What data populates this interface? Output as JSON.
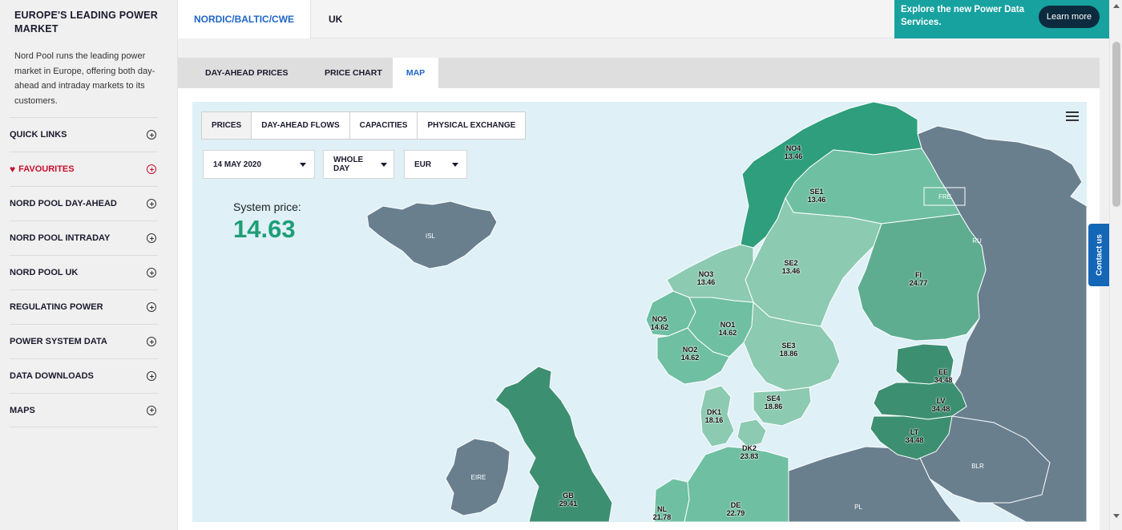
{
  "sidebar": {
    "title": "EUROPE'S LEADING POWER MARKET",
    "description": "Nord Pool runs the leading power market in Europe, offering both day-ahead and intraday markets to its customers.",
    "items": [
      {
        "label": "QUICK LINKS"
      },
      {
        "label": "FAVOURITES"
      },
      {
        "label": "NORD POOL DAY-AHEAD"
      },
      {
        "label": "NORD POOL INTRADAY"
      },
      {
        "label": "NORD POOL UK"
      },
      {
        "label": "REGULATING POWER"
      },
      {
        "label": "POWER SYSTEM DATA"
      },
      {
        "label": "DATA DOWNLOADS"
      },
      {
        "label": "MAPS"
      }
    ]
  },
  "header": {
    "region_tabs": [
      "NORDIC/BALTIC/CWE",
      "UK"
    ],
    "promo": {
      "text": "Explore the new Power Data Services.",
      "button": "Learn more"
    }
  },
  "view_tabs": [
    "DAY-AHEAD PRICES",
    "PRICE CHART",
    "MAP"
  ],
  "map": {
    "mode_tabs": [
      "PRICES",
      "DAY-AHEAD FLOWS",
      "CAPACITIES",
      "PHYSICAL EXCHANGE"
    ],
    "date": "14 MAY 2020",
    "period": "WHOLE DAY",
    "currency": "EUR",
    "system_price_label": "System price:",
    "system_price_value": "14.63",
    "zones": [
      {
        "code": "NO4",
        "price": "13.46"
      },
      {
        "code": "SE1",
        "price": "13.46"
      },
      {
        "code": "SE2",
        "price": "13.46"
      },
      {
        "code": "NO3",
        "price": "13.46"
      },
      {
        "code": "FI",
        "price": "24.77"
      },
      {
        "code": "NO5",
        "price": "14.62"
      },
      {
        "code": "NO1",
        "price": "14.62"
      },
      {
        "code": "NO2",
        "price": "14.62"
      },
      {
        "code": "SE3",
        "price": "18.86"
      },
      {
        "code": "EE",
        "price": "34.48"
      },
      {
        "code": "LV",
        "price": "34.48"
      },
      {
        "code": "LT",
        "price": "34.48"
      },
      {
        "code": "SE4",
        "price": "18.86"
      },
      {
        "code": "DK1",
        "price": "18.16"
      },
      {
        "code": "DK2",
        "price": "23.83"
      },
      {
        "code": "GB",
        "price": "29.41"
      },
      {
        "code": "NL",
        "price": "21.78"
      },
      {
        "code": "DE",
        "price": "22.79"
      }
    ],
    "other_areas": [
      "ISL",
      "FRE",
      "RU",
      "EIRE",
      "BLR",
      "PL"
    ]
  },
  "contact_label": "Contact us",
  "colors": {
    "accent": "#1f66c7",
    "promo_bg": "#17a2a0",
    "price_green": "#1e9e77",
    "favourite_red": "#c8102e"
  }
}
